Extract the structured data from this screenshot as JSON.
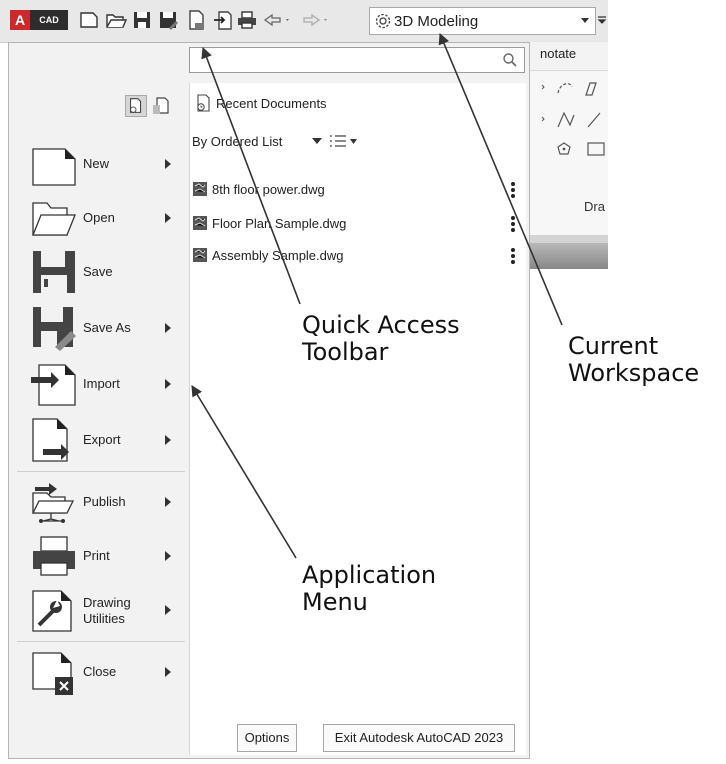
{
  "quick_access_toolbar": {
    "app_logo_letter": "A",
    "app_logo_text": "CAD",
    "icons": [
      "new-icon",
      "open-icon",
      "save-icon",
      "save-as-icon",
      "publish-icon",
      "import-icon",
      "plot-icon",
      "undo-icon",
      "redo-icon"
    ],
    "workspace": {
      "label": "3D Modeling",
      "icon": "gear-icon"
    }
  },
  "ribbon": {
    "tab_partial": "notate",
    "panel_title_partial": "Dra"
  },
  "app_menu": {
    "search": {
      "placeholder": ""
    },
    "menu_items": [
      {
        "label": "New",
        "icon": "new-file-icon",
        "submenu": true
      },
      {
        "label": "Open",
        "icon": "open-folder-icon",
        "submenu": true
      },
      {
        "label": "Save",
        "icon": "save-icon",
        "submenu": false
      },
      {
        "label": "Save As",
        "icon": "save-as-icon",
        "submenu": true
      },
      {
        "label": "Import",
        "icon": "import-icon",
        "submenu": true
      },
      {
        "label": "Export",
        "icon": "export-icon",
        "submenu": true
      },
      {
        "label": "Publish",
        "icon": "publish-icon",
        "submenu": true
      },
      {
        "label": "Print",
        "icon": "printer-icon",
        "submenu": true
      },
      {
        "label_line1": "Drawing",
        "label_line2": "Utilities",
        "icon": "wrench-icon",
        "submenu": true
      },
      {
        "label": "Close",
        "icon": "close-file-icon",
        "submenu": true
      }
    ],
    "recent": {
      "title": "Recent Documents",
      "sort_label": "By Ordered List",
      "documents": [
        {
          "name": "8th floor power.dwg"
        },
        {
          "name": "Floor Plan Sample.dwg"
        },
        {
          "name": "Assembly Sample.dwg"
        }
      ]
    },
    "options_label": "Options",
    "exit_label": "Exit Autodesk AutoCAD 2023"
  },
  "annotations": {
    "quick_access_line1": "Quick Access",
    "quick_access_line2": "Toolbar",
    "workspace_line1": "Current",
    "workspace_line2": "Workspace",
    "app_menu_line1": "Application",
    "app_menu_line2": "Menu"
  }
}
